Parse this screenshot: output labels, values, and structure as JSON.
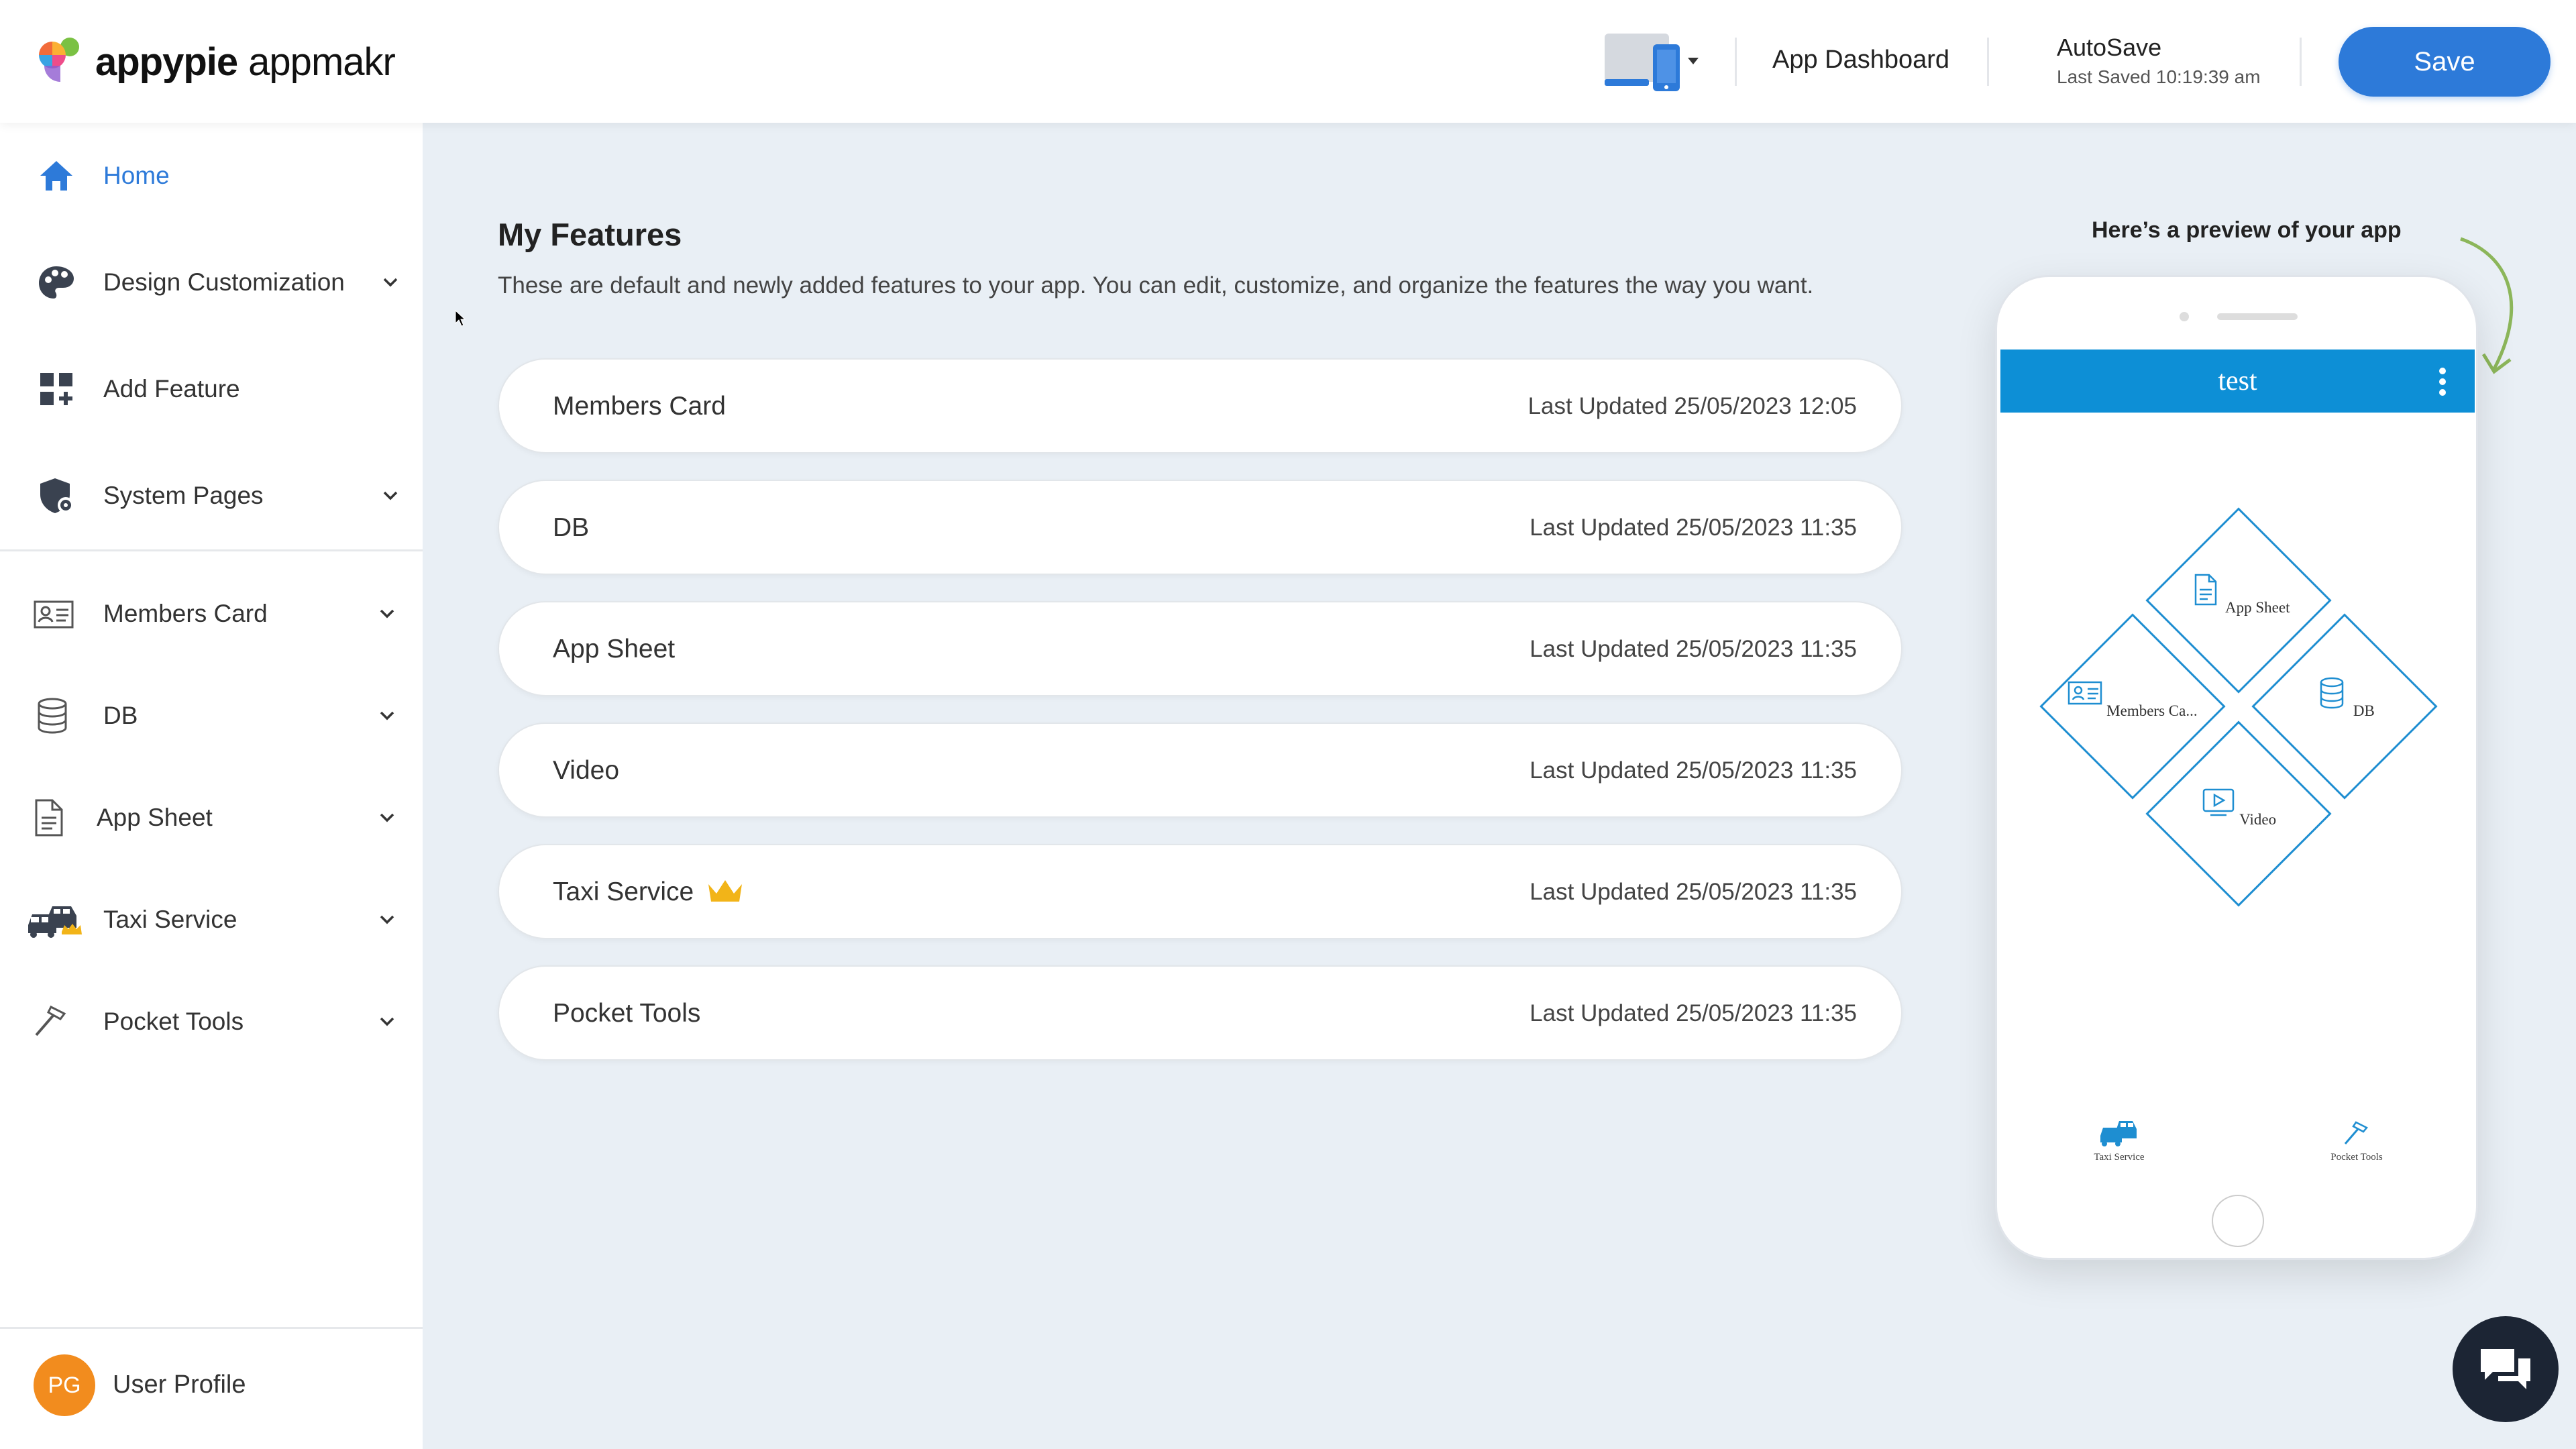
{
  "header": {
    "brand_primary": "appypie",
    "brand_secondary": "appmakr",
    "dashboard_label": "App Dashboard",
    "autosave_label": "AutoSave",
    "last_saved": "Last Saved 10:19:39 am",
    "save_label": "Save"
  },
  "sidebar": {
    "items": [
      {
        "label": "Home",
        "icon": "home-icon",
        "active": true
      },
      {
        "label": "Design Customization",
        "icon": "palette-icon"
      },
      {
        "label": "Add Feature",
        "icon": "add-grid-icon"
      },
      {
        "label": "System Pages",
        "icon": "shield-gear-icon"
      },
      {
        "label": "Members Card",
        "icon": "id-card-icon"
      },
      {
        "label": "DB",
        "icon": "database-icon"
      },
      {
        "label": "App Sheet",
        "icon": "document-icon"
      },
      {
        "label": "Taxi Service",
        "icon": "taxi-icon"
      },
      {
        "label": "Pocket Tools",
        "icon": "hammer-icon"
      }
    ],
    "profile": {
      "initials": "PG",
      "label": "User Profile"
    }
  },
  "main": {
    "title": "My Features",
    "subtitle": "These are default and newly added features to your app. You can edit, customize, and organize the features the way you want.",
    "features": [
      {
        "name": "Members Card",
        "updated": "Last Updated 25/05/2023 12:05"
      },
      {
        "name": "DB",
        "updated": "Last Updated 25/05/2023 11:35"
      },
      {
        "name": "App Sheet",
        "updated": "Last Updated 25/05/2023 11:35"
      },
      {
        "name": "Video",
        "updated": "Last Updated 25/05/2023 11:35"
      },
      {
        "name": "Taxi Service",
        "updated": "Last Updated 25/05/2023 11:35",
        "premium": true
      },
      {
        "name": "Pocket Tools",
        "updated": "Last Updated 25/05/2023 11:35"
      }
    ]
  },
  "preview": {
    "label": "Here’s a preview of your app",
    "app_title": "test",
    "tiles": [
      "App Sheet",
      "Members Ca...",
      "DB",
      "Video"
    ],
    "bottom_tabs": [
      "Taxi Service",
      "Pocket Tools"
    ]
  },
  "colors": {
    "accent": "#2d7ad9",
    "phone_bar": "#0d8fd6",
    "avatar": "#f28c1e",
    "crown": "#f2b418",
    "arrow": "#8cb65a"
  }
}
